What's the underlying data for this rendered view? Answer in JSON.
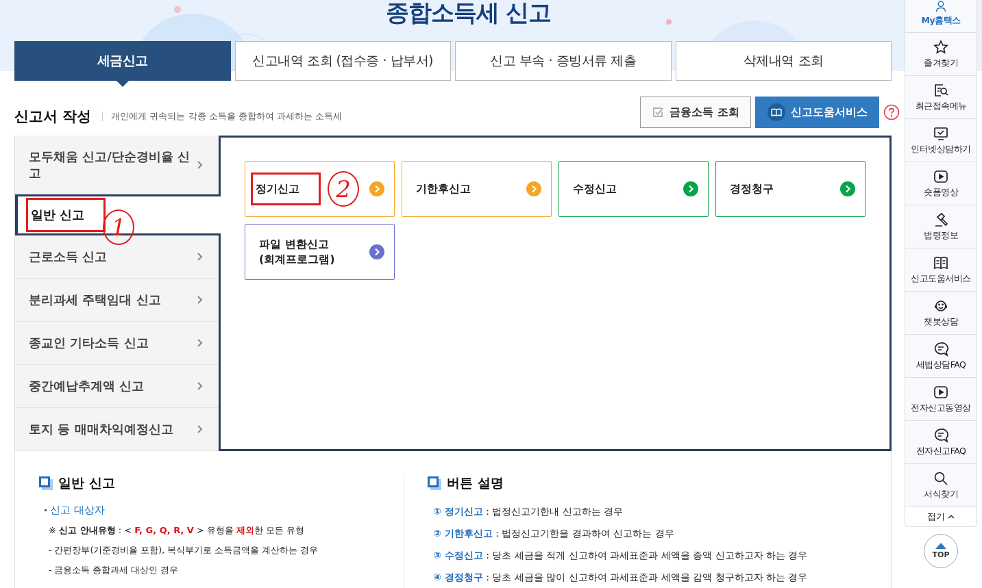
{
  "page_title": "종합소득세 신고",
  "tabs": [
    {
      "label": "세금신고",
      "selected": true
    },
    {
      "label": "신고내역 조회 (접수증 · 납부서)",
      "selected": false
    },
    {
      "label": "신고 부속 · 증빙서류 제출",
      "selected": false
    },
    {
      "label": "삭제내역 조회",
      "selected": false
    }
  ],
  "section": {
    "title": "신고서 작성",
    "description": "개인에게 귀속되는 각종 소득을 종합하여 과세하는 소득세"
  },
  "actions": [
    {
      "label": "금융소득 조회",
      "kind": "outline"
    },
    {
      "label": "신고도움서비스",
      "kind": "primary"
    }
  ],
  "menu": [
    {
      "label": "모두채움 신고/단순경비율 신고",
      "selected": false
    },
    {
      "label": "일반 신고",
      "selected": true,
      "annotation": "1"
    },
    {
      "label": "근로소득 신고",
      "selected": false
    },
    {
      "label": "분리과세 주택임대 신고",
      "selected": false
    },
    {
      "label": "종교인 기타소득 신고",
      "selected": false
    },
    {
      "label": "중간예납추계액 신고",
      "selected": false
    },
    {
      "label": "토지 등 매매차익예정신고",
      "selected": false
    }
  ],
  "cards": [
    {
      "label": "정기신고",
      "color": "#f5a623",
      "annotation": "2"
    },
    {
      "label": "기한후신고",
      "color": "#f5a623"
    },
    {
      "label": "수정신고",
      "color": "#0aa24a"
    },
    {
      "label": "경정청구",
      "color": "#0aa24a"
    },
    {
      "label": "파일 변환신고\n(회계프로그램)",
      "color": "#6a70cf"
    }
  ],
  "info_left": {
    "title": "일반 신고",
    "subtitle": "신고 대상자",
    "note": [
      {
        "text": "※ ",
        "kind": "plain"
      },
      {
        "text": "신고 안내유형",
        "kind": "bold"
      },
      {
        "text": " : < ",
        "kind": "plain"
      },
      {
        "text": "F, G, Q, R, V",
        "kind": "red"
      },
      {
        "text": " > 유형을 ",
        "kind": "plain"
      },
      {
        "text": "제외",
        "kind": "red"
      },
      {
        "text": "한 모든 유형",
        "kind": "plain"
      }
    ],
    "lines": [
      "- 간편장부(기준경비율 포함), 복식부기로 소득금액을 계산하는 경우",
      "- 금융소득 종합과세 대상인 경우"
    ]
  },
  "info_right": {
    "title": "버튼 설명",
    "items": [
      {
        "number": "①",
        "term": "정기신고",
        "text": " : 법정신고기한내 신고하는 경우"
      },
      {
        "number": "②",
        "term": "기한후신고",
        "text": " : 법정신고기한을 경과하여 신고하는 경우"
      },
      {
        "number": "③",
        "term": "수정신고",
        "text": " : 당초 세금을 적게 신고하여 과세표준과 세액을 증액 신고하고자 하는 경우"
      },
      {
        "number": "④",
        "term": "경정청구",
        "text": " : 당초 세금을 많이 신고하여 과세표준과 세액을 감액 청구하고자 하는 경우"
      }
    ]
  },
  "quick_menu": [
    {
      "label": "My홈택스",
      "kind": "user",
      "selected": true
    },
    {
      "label": "즐겨찾기",
      "kind": "star",
      "selected": false
    },
    {
      "label": "최근접속메뉴",
      "kind": "docsearch",
      "selected": false
    },
    {
      "label": "인터넷상담하기",
      "kind": "monitor",
      "selected": false
    },
    {
      "label": "숏폼영상",
      "kind": "play",
      "selected": false
    },
    {
      "label": "법령정보",
      "kind": "gavel",
      "selected": false
    },
    {
      "label": "신고도움서비스",
      "kind": "book",
      "selected": false
    },
    {
      "label": "챗봇상담",
      "kind": "headset",
      "selected": false
    },
    {
      "label": "세법상담FAQ",
      "kind": "chat",
      "selected": false
    },
    {
      "label": "전자신고동영상",
      "kind": "play",
      "selected": false
    },
    {
      "label": "전자신고FAQ",
      "kind": "chat",
      "selected": false
    },
    {
      "label": "서식찾기",
      "kind": "search",
      "selected": false
    }
  ],
  "collapse": "접기",
  "top_button": "TOP"
}
